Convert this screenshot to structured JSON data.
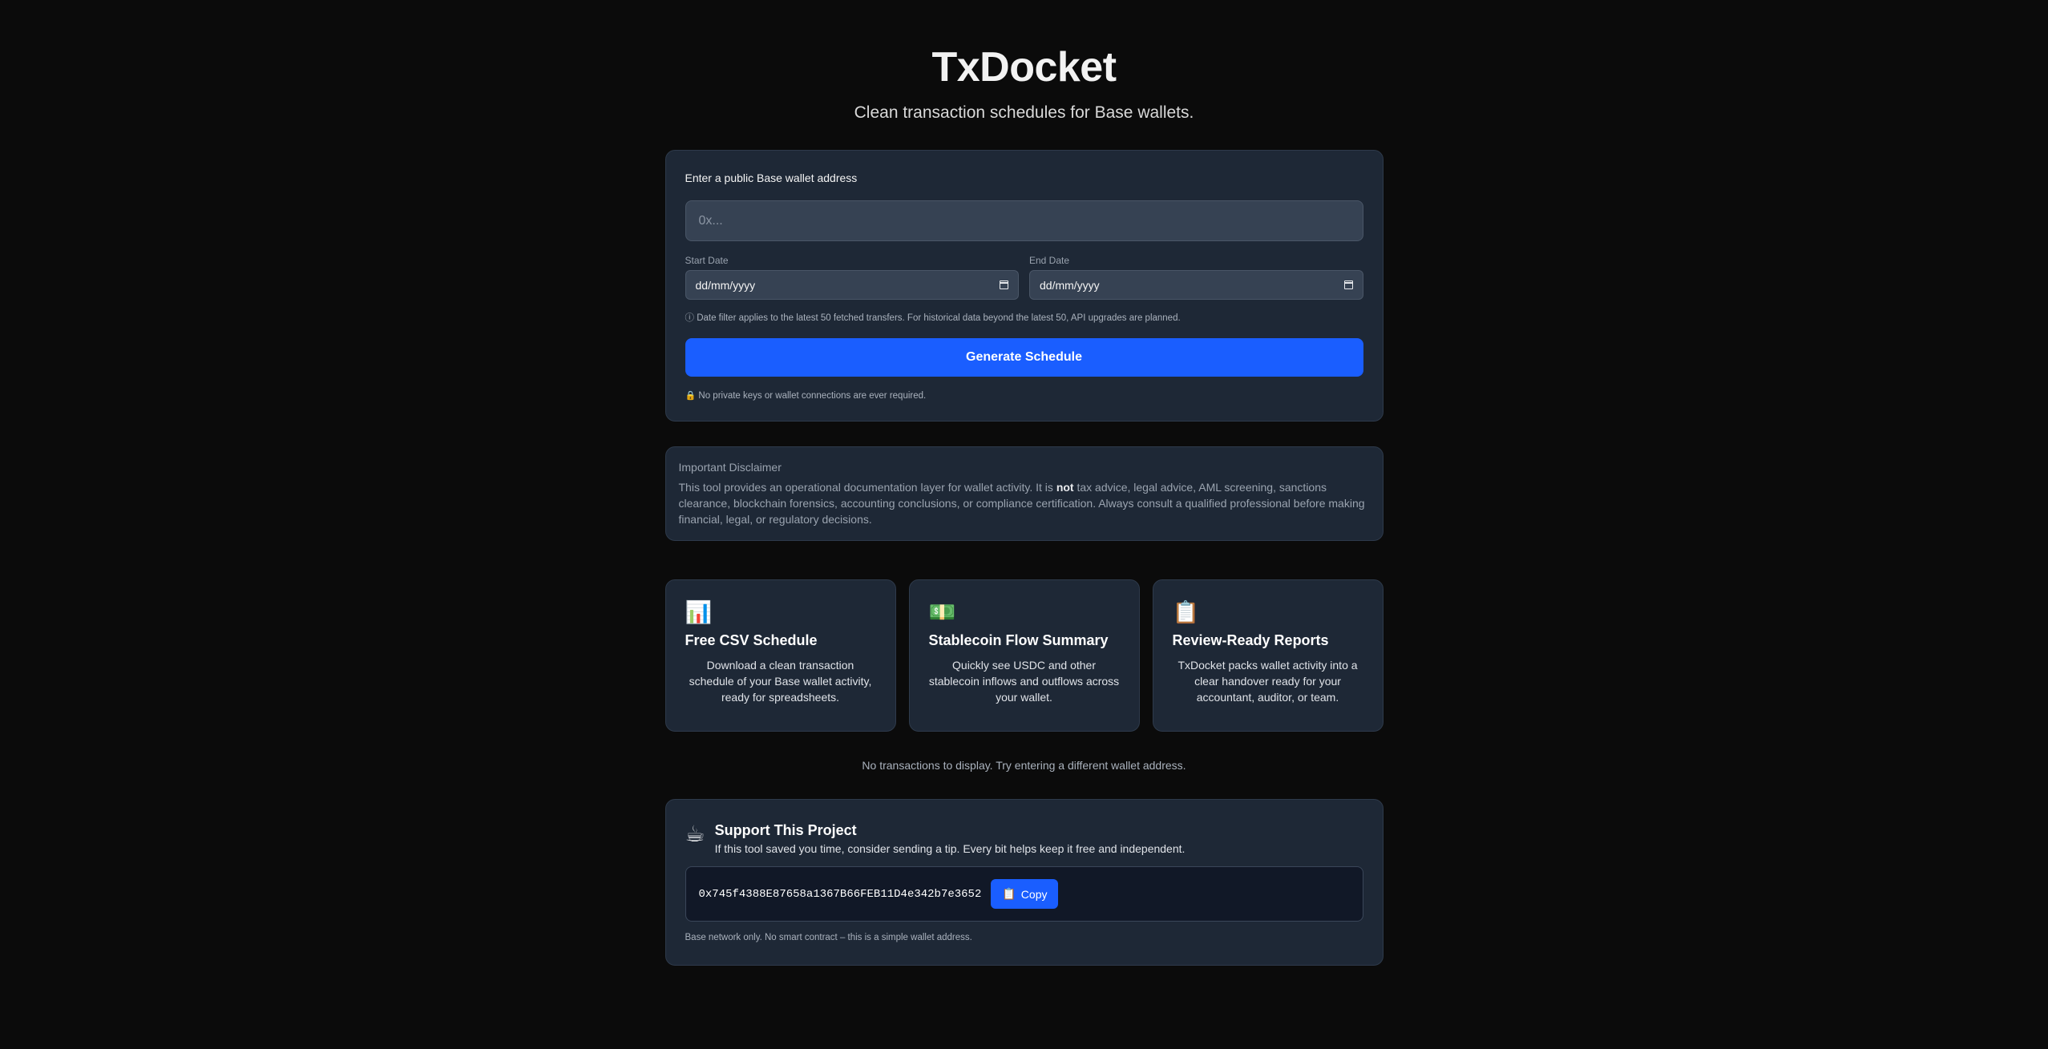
{
  "header": {
    "title": "TxDocket",
    "subtitle": "Clean transaction schedules for Base wallets."
  },
  "form": {
    "wallet_label": "Enter a public Base wallet address",
    "wallet_placeholder": "0x...",
    "wallet_value": "",
    "start_label": "Start Date",
    "start_value": "dd/mm/yyyy",
    "end_label": "End Date",
    "end_value": "dd/mm/yyyy",
    "date_note": "ⓘ Date filter applies to the latest 50 fetched transfers. For historical data beyond the latest 50, API upgrades are planned.",
    "generate_label": "Generate Schedule",
    "privacy_icon": "🔒",
    "privacy_note": "No private keys or wallet connections are ever required."
  },
  "disclaimer": {
    "title": "Important Disclaimer",
    "text_before": "This tool provides an operational documentation layer for wallet activity. It is ",
    "text_bold": "not",
    "text_after": " tax advice, legal advice, AML screening, sanctions clearance, blockchain forensics, accounting conclusions, or compliance certification. Always consult a qualified professional before making financial, legal, or regulatory decisions."
  },
  "features": [
    {
      "icon": "📊",
      "icon_name": "bar-chart-icon",
      "title": "Free CSV Schedule",
      "text": "Download a clean transaction schedule of your Base wallet activity, ready for spreadsheets."
    },
    {
      "icon": "💵",
      "icon_name": "dollar-banknote-icon",
      "title": "Stablecoin Flow Summary",
      "text": "Quickly see USDC and other stablecoin inflows and outflows across your wallet."
    },
    {
      "icon": "📋",
      "icon_name": "clipboard-icon",
      "title": "Review-Ready Reports",
      "text": "TxDocket packs wallet activity into a clear handover ready for your accountant, auditor, or team."
    }
  ],
  "results": {
    "empty_message": "No transactions to display. Try entering a different wallet address."
  },
  "support": {
    "icon": "☕",
    "title": "Support This Project",
    "subtitle": "If this tool saved you time, consider sending a tip. Every bit helps keep it free and independent.",
    "address": "0x745f4388E87658a1367B66FEB11D4e342b7e3652",
    "copy_icon": "📋",
    "copy_label": "Copy",
    "footnote": "Base network only. No smart contract – this is a simple wallet address."
  },
  "colors": {
    "background": "#0b0b0b",
    "card": "#1e2836",
    "accent": "#1a5eff"
  }
}
